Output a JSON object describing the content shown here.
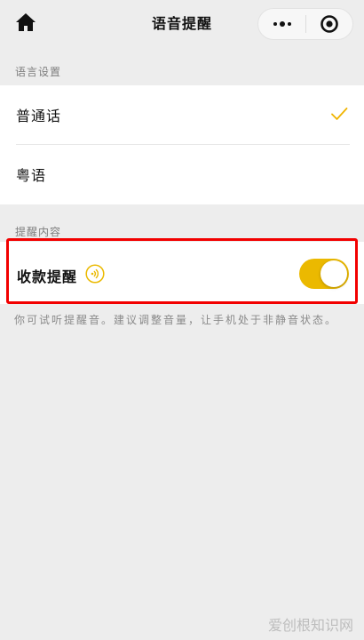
{
  "header": {
    "title": "语音提醒",
    "home_icon": "home-icon",
    "more_icon": "more-dots-icon",
    "close_icon": "target-close-icon"
  },
  "language_section": {
    "label": "语言设置",
    "options": [
      {
        "label": "普通话",
        "selected": true
      },
      {
        "label": "粤语",
        "selected": false
      }
    ]
  },
  "reminder_section": {
    "label": "提醒内容",
    "item": {
      "label": "收款提醒",
      "icon": "sound-wave-icon",
      "toggle_on": true
    },
    "hint": "你可试听提醒音。建议调整音量，让手机处于非静音状态。"
  },
  "watermark": "爱创根知识网",
  "colors": {
    "accent": "#ebb900",
    "check": "#f0b400",
    "highlight": "#f20000",
    "background": "#ededed"
  }
}
